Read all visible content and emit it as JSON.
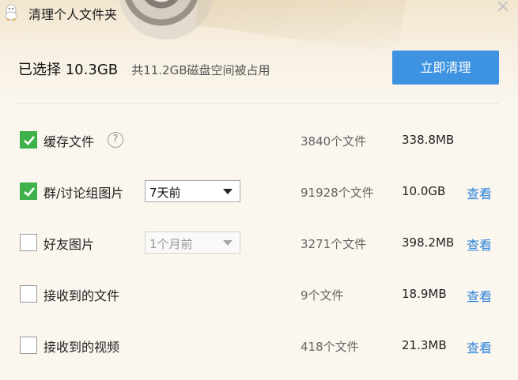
{
  "window": {
    "title": "清理个人文件夹",
    "close": "✕"
  },
  "summary": {
    "selected_prefix": "已选择",
    "selected_value": "10.3GB",
    "occupied_text": "共11.2GB磁盘空间被占用"
  },
  "clean_button": "立即清理",
  "rows": [
    {
      "label": "缓存文件",
      "checked": true,
      "help": "?",
      "count": "3840个文件",
      "size": "338.8MB"
    },
    {
      "label": "群/讨论组图片",
      "checked": true,
      "select": "7天前",
      "count": "91928个文件",
      "size": "10.0GB",
      "view": "查看"
    },
    {
      "label": "好友图片",
      "checked": false,
      "select": "1个月前",
      "select_disabled": true,
      "count": "3271个文件",
      "size": "398.2MB",
      "view": "查看"
    },
    {
      "label": "接收到的文件",
      "checked": false,
      "count": "9个文件",
      "size": "18.9MB",
      "view": "查看"
    },
    {
      "label": "接收到的视频",
      "checked": false,
      "count": "418个文件",
      "size": "21.3MB",
      "view": "查看"
    }
  ],
  "colors": {
    "accent": "#3d93e1",
    "check": "#3fb14b",
    "link": "#2e83d8"
  }
}
